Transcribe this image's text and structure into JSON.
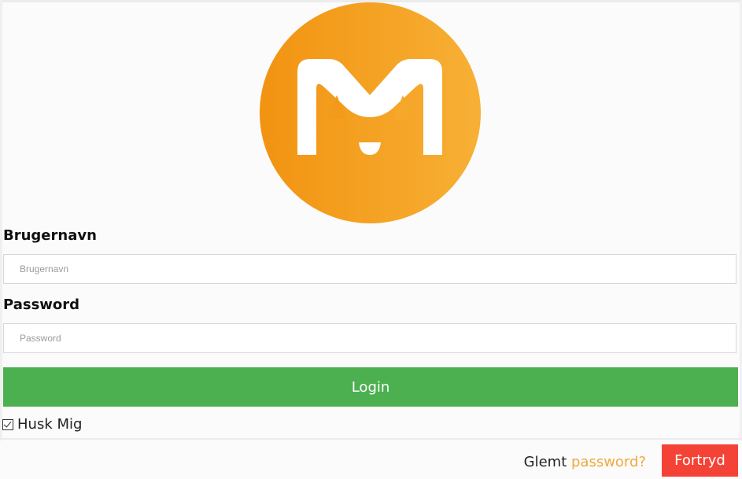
{
  "logo": {
    "icon": "cat-m-logo-icon",
    "gradient_start": "#f29311",
    "gradient_end": "#f7b035"
  },
  "form": {
    "username_label": "Brugernavn",
    "username_placeholder": "Brugernavn",
    "username_value": "",
    "password_label": "Password",
    "password_placeholder": "Password",
    "password_value": "",
    "login_label": "Login",
    "remember_label": "Husk Mig",
    "remember_checked": true
  },
  "footer": {
    "forgot_prefix": "Glemt ",
    "forgot_link": "password?",
    "cancel_label": "Fortryd"
  },
  "colors": {
    "login_button": "#4caf50",
    "cancel_button": "#f44336",
    "link": "#f0a93e"
  }
}
